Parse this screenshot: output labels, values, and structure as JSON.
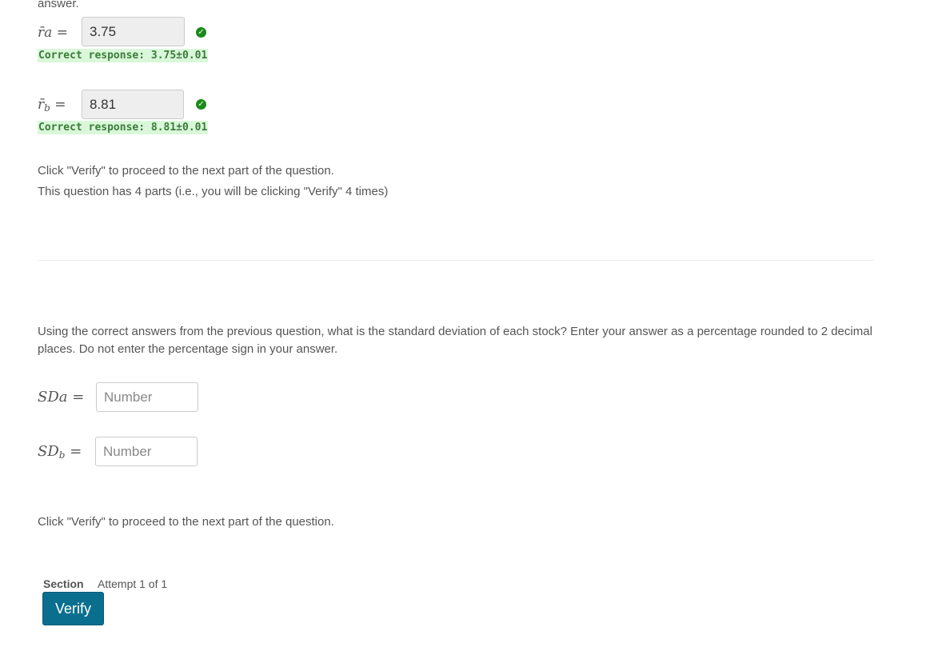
{
  "top_fragment": "answer.",
  "part1": {
    "ra": {
      "label": "r̄",
      "sub": "a",
      "value": "3.75",
      "correct": "Correct response: 3.75±0.01",
      "status_icon": "check-circle-icon"
    },
    "rb": {
      "label": "r̄",
      "sub": "b",
      "value": "8.81",
      "correct": "Correct response: 8.81±0.01",
      "status_icon": "check-circle-icon"
    },
    "instruction_1": "Click \"Verify\" to proceed to the next part of the question.",
    "instruction_2": "This question has 4 parts (i.e., you will be clicking \"Verify\" 4 times)"
  },
  "part2": {
    "question": "Using the correct answers from the previous question, what is the standard deviation of each stock? Enter your answer as a percentage rounded to 2 decimal places.  Do not enter the percentage sign in your answer.",
    "sda": {
      "label": "SD",
      "sub": "a",
      "value": "",
      "placeholder": "Number"
    },
    "sdb": {
      "label": "SD",
      "sub": "b",
      "value": "",
      "placeholder": "Number"
    },
    "instruction": "Click \"Verify\" to proceed to the next part of the question."
  },
  "footer": {
    "section_label": "Section",
    "attempt_text": "Attempt 1 of 1",
    "verify_label": "Verify"
  },
  "colors": {
    "correct_bg": "#d9f7d9",
    "correct_text": "#3c7a3c",
    "check_green": "#1a8a1a",
    "verify_button": "#0a6f8f"
  }
}
